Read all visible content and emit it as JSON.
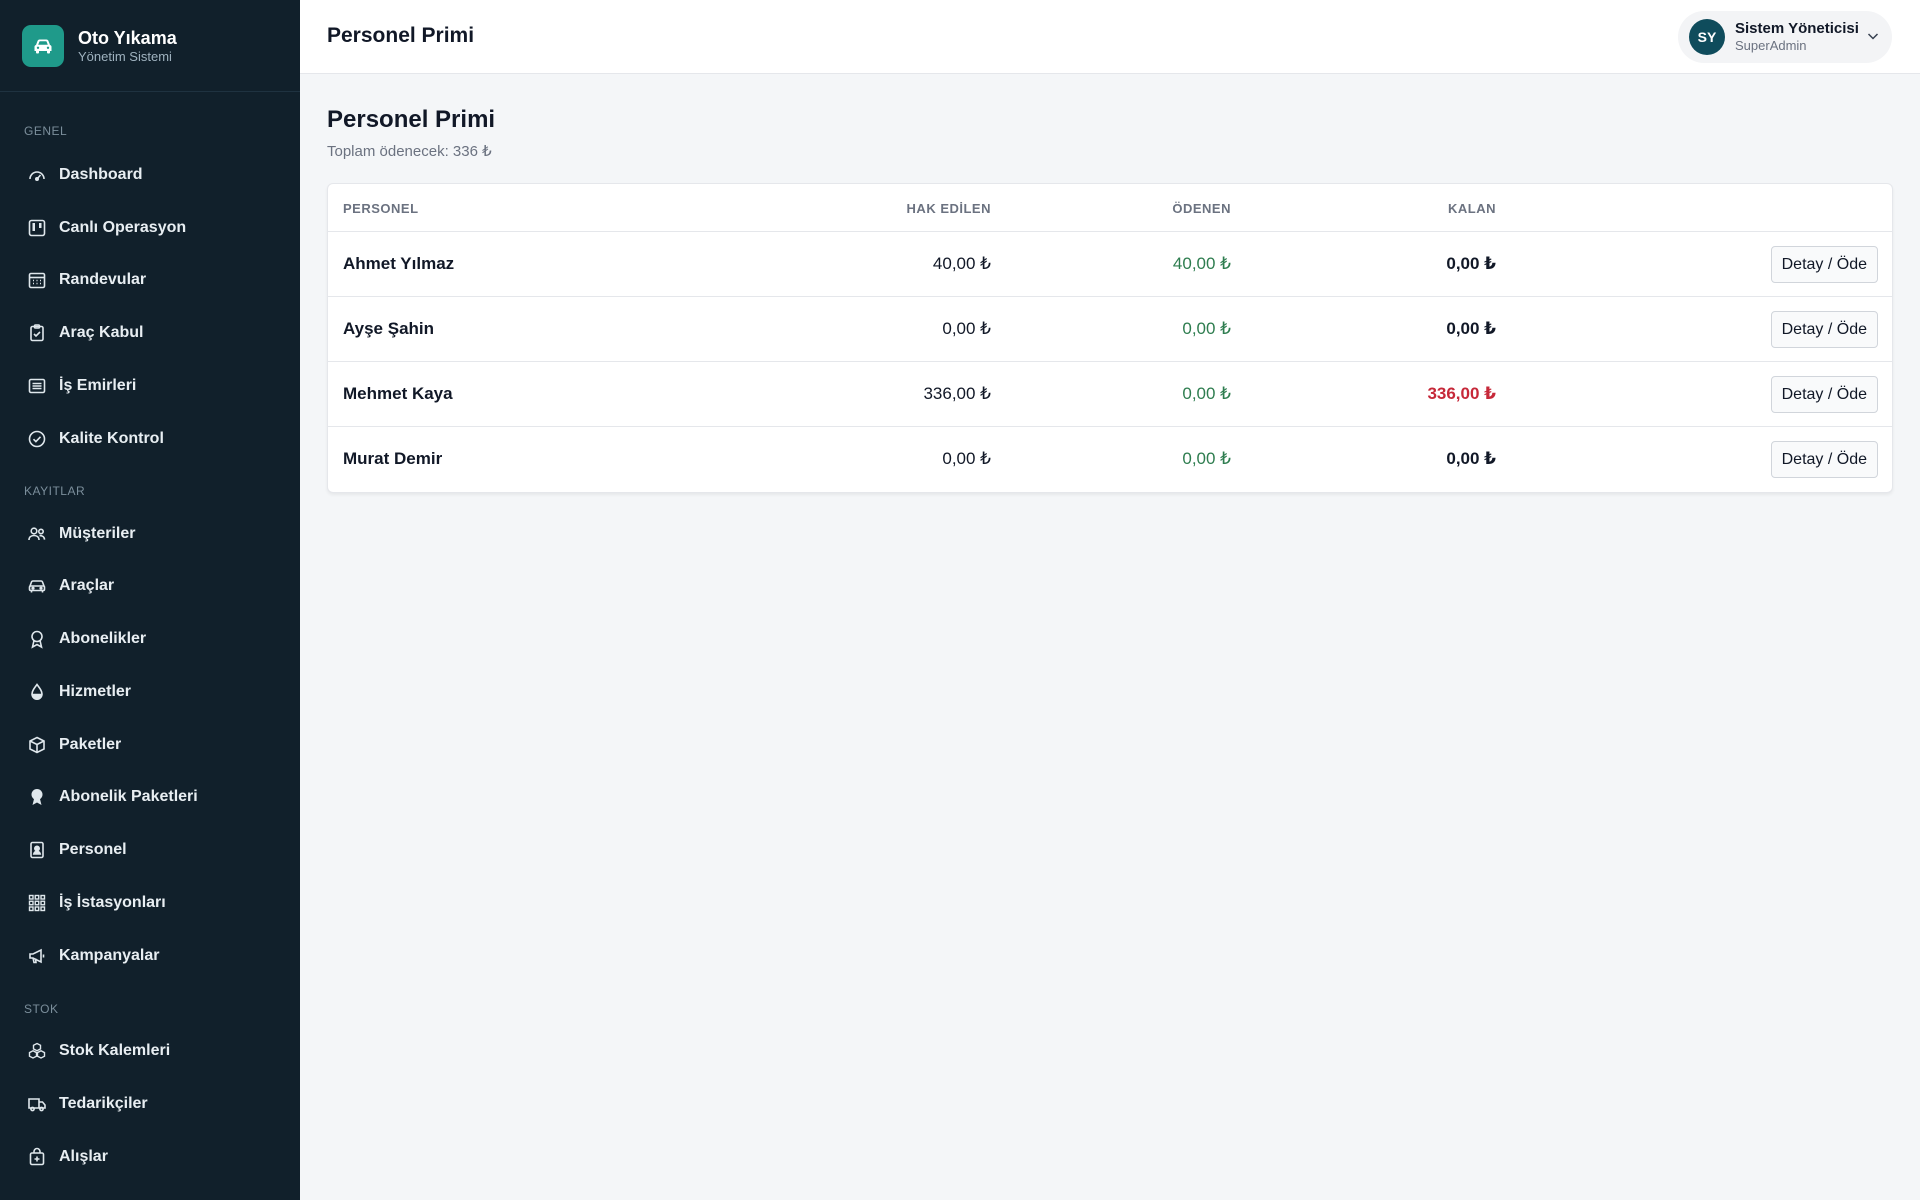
{
  "brand": {
    "title": "Oto Yıkama",
    "subtitle": "Yönetim Sistemi"
  },
  "sidebar": {
    "sections": [
      {
        "label": "GENEL"
      },
      {
        "label": "KAYITLAR"
      },
      {
        "label": "STOK"
      }
    ],
    "items": [
      {
        "label": "Dashboard",
        "icon": "gauge-icon"
      },
      {
        "label": "Canlı Operasyon",
        "icon": "kanban-icon"
      },
      {
        "label": "Randevular",
        "icon": "calendar-icon"
      },
      {
        "label": "Araç Kabul",
        "icon": "clipboard-check-icon"
      },
      {
        "label": "İş Emirleri",
        "icon": "list-icon"
      },
      {
        "label": "Kalite Kontrol",
        "icon": "check-circle-icon"
      },
      {
        "label": "Müşteriler",
        "icon": "users-icon"
      },
      {
        "label": "Araçlar",
        "icon": "car-icon"
      },
      {
        "label": "Abonelikler",
        "icon": "award-icon"
      },
      {
        "label": "Hizmetler",
        "icon": "droplet-icon"
      },
      {
        "label": "Paketler",
        "icon": "box-icon"
      },
      {
        "label": "Abonelik Paketleri",
        "icon": "award-fill-icon"
      },
      {
        "label": "Personel",
        "icon": "id-badge-icon"
      },
      {
        "label": "İş İstasyonları",
        "icon": "grid-icon"
      },
      {
        "label": "Kampanyalar",
        "icon": "megaphone-icon"
      },
      {
        "label": "Stok Kalemleri",
        "icon": "boxes-icon"
      },
      {
        "label": "Tedarikçiler",
        "icon": "truck-icon"
      },
      {
        "label": "Alışlar",
        "icon": "bag-plus-icon"
      }
    ]
  },
  "header": {
    "title": "Personel Primi",
    "user": {
      "initials": "SY",
      "name": "Sistem Yöneticisi",
      "role": "SuperAdmin"
    }
  },
  "main": {
    "title": "Personel Primi",
    "subtitle": "Toplam ödenecek: 336 ₺",
    "table": {
      "columns": [
        "PERSONEL",
        "HAK EDİLEN",
        "ÖDENEN",
        "KALAN"
      ],
      "action_label": "Detay / Öde",
      "rows": [
        {
          "name": "Ahmet Yılmaz",
          "earned": "40,00 ₺",
          "paid": "40,00 ₺",
          "remaining": "0,00 ₺",
          "outstanding": false
        },
        {
          "name": "Ayşe Şahin",
          "earned": "0,00 ₺",
          "paid": "0,00 ₺",
          "remaining": "0,00 ₺",
          "outstanding": false
        },
        {
          "name": "Mehmet Kaya",
          "earned": "336,00 ₺",
          "paid": "0,00 ₺",
          "remaining": "336,00 ₺",
          "outstanding": true
        },
        {
          "name": "Murat Demir",
          "earned": "0,00 ₺",
          "paid": "0,00 ₺",
          "remaining": "0,00 ₺",
          "outstanding": false
        }
      ]
    }
  },
  "colors": {
    "sidebar_bg": "#11202b",
    "brand_accent": "#1f9a8a",
    "paid_green": "#2e7d4f",
    "outstanding_red": "#c62839",
    "avatar_bg": "#0f4c5c"
  }
}
